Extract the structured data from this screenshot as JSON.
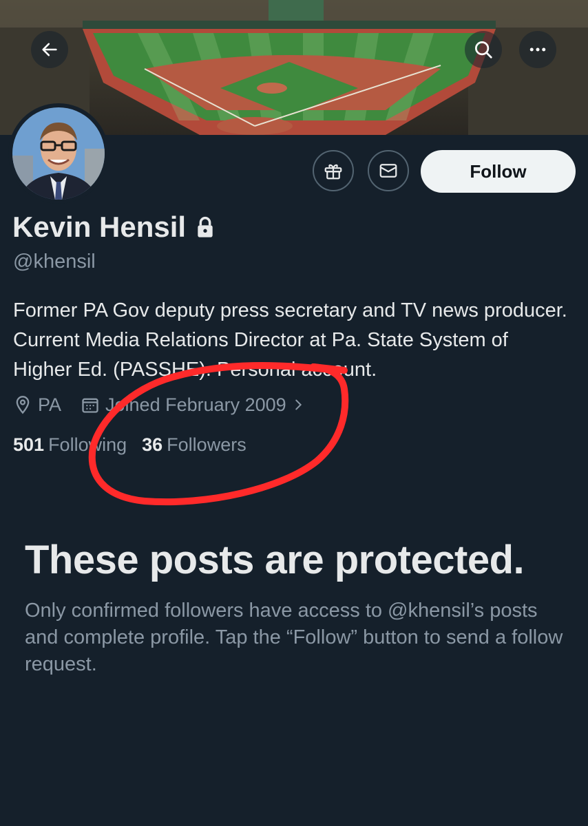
{
  "profile": {
    "name": "Kevin Hensil",
    "handle": "@khensil",
    "bio": "Former PA Gov deputy press secretary and TV news producer. Current Media Relations Director at Pa. State System of Higher Ed. (PASSHE). Personal account.",
    "location": "PA",
    "joined": "Joined February 2009",
    "following_count": "501",
    "following_label": "Following",
    "followers_count": "36",
    "followers_label": "Followers",
    "verified_locked": true
  },
  "actions": {
    "follow_label": "Follow"
  },
  "protected": {
    "title": "These posts are protected.",
    "body": "Only confirmed followers have access to @khensil’s posts and complete profile. Tap the “Follow” button to send a follow request."
  },
  "icons": {
    "back": "back-arrow-icon",
    "search": "search-icon",
    "more": "more-icon",
    "gift": "gift-icon",
    "message": "envelope-icon",
    "lock": "lock-icon",
    "location": "location-pin-icon",
    "calendar": "calendar-icon",
    "chevron": "chevron-right-icon"
  },
  "colors": {
    "background": "#15202b",
    "primary_text": "#e7e9ea",
    "secondary_text": "#8b98a5",
    "follow_button": "#eff3f4",
    "annotation": "#ff2a2a"
  }
}
